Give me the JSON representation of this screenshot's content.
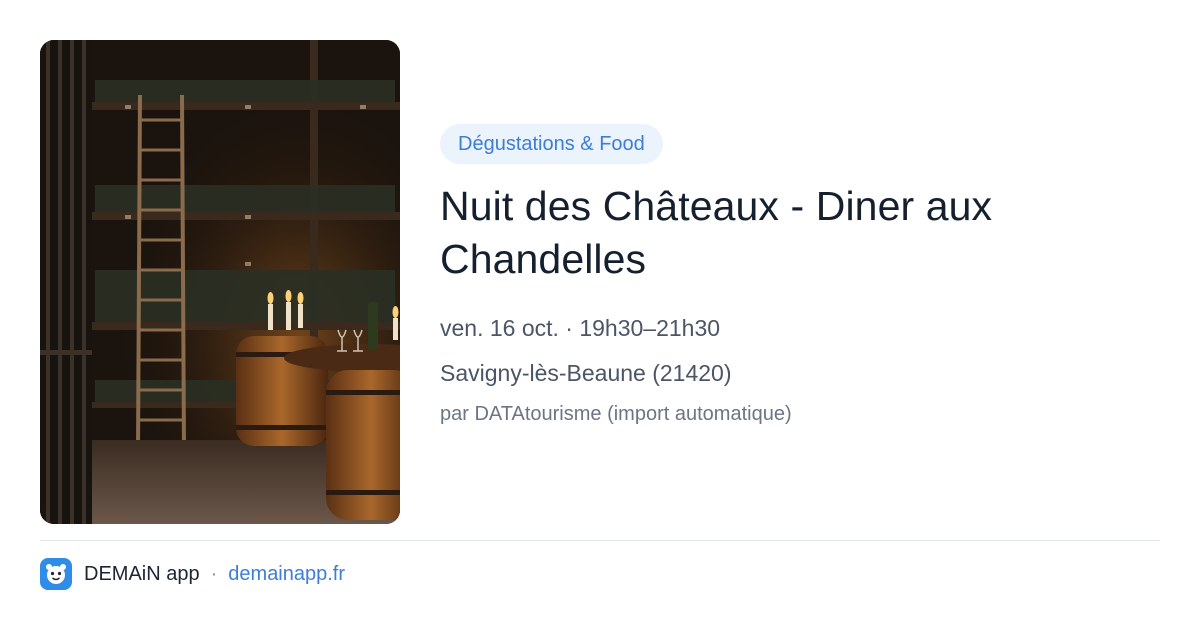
{
  "event": {
    "category": "Dégustations & Food",
    "title": "Nuit des Châteaux - Diner aux Chandelles",
    "datetime": "ven. 16 oct. · 19h30–21h30",
    "location": "Savigny-lès-Beaune (21420)",
    "source": "par DATAtourisme (import automatique)"
  },
  "footer": {
    "app_name": "DEMAiN app",
    "separator": "·",
    "domain": "demainapp.fr"
  },
  "icons": {
    "app": "app-logo-icon"
  },
  "colors": {
    "accent": "#3d7dd8",
    "badge_bg": "#ebf3fc",
    "app_icon_bg": "#2f8de8"
  }
}
